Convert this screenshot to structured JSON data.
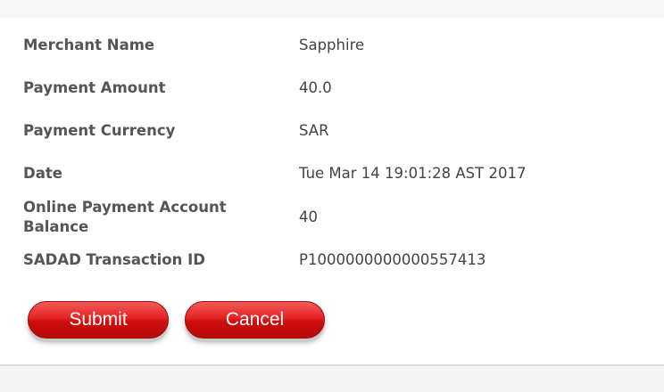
{
  "details": [
    {
      "label": "Merchant Name",
      "value": "Sapphire"
    },
    {
      "label": "Payment Amount",
      "value": "40.0"
    },
    {
      "label": "Payment Currency",
      "value": "SAR"
    },
    {
      "label": "Date",
      "value": "Tue Mar 14 19:01:28 AST 2017"
    },
    {
      "label": "Online Payment Account Balance",
      "value": "40"
    },
    {
      "label": "SADAD Transaction ID",
      "value": "P1000000000000557413"
    }
  ],
  "actions": {
    "submit_label": "Submit",
    "cancel_label": "Cancel"
  },
  "colors": {
    "button_red": "#d91414",
    "label_gray": "#555555",
    "value_gray": "#444444"
  }
}
